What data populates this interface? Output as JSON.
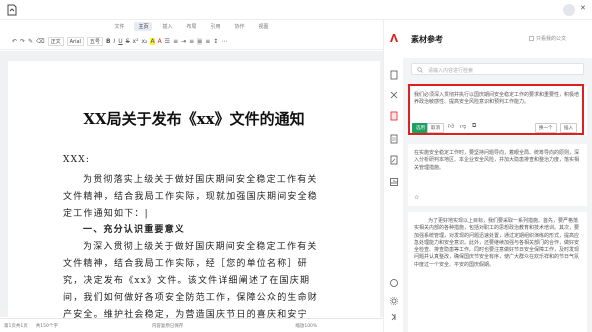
{
  "menu": {
    "tabs": [
      "文件",
      "主页",
      "插入",
      "布局",
      "引用",
      "协作",
      "视图"
    ],
    "active": "主页"
  },
  "toolbar": {
    "font_style": "正文",
    "font_name": "Arial",
    "font_size": "五号"
  },
  "document": {
    "title": "XX局关于发布《xx》文件的通知",
    "lines": [
      "XXX:",
      "为贯彻落实上级关于做好国庆期间安全稳定工作有关",
      "文件精神，结合我局工作实际，现就加强国庆期间安全稳",
      "定工作通知如下：|",
      "一、充分认识重要意义",
      "为深入贯彻上级关于做好国庆期间安全稳定工作有关",
      "文件精神，结合我局工作实际，经［您的单位名称］研",
      "究，决定发布《xx》文件。该文件详细阐述了在国庆期",
      "间，我们如何做好各项安全防范工作，保障公众的生命财",
      "产安全。维护社会稳定，为营造国庆节日的喜庆和安宁"
    ]
  },
  "status": {
    "page": "第1页共1页",
    "words": "共150个字",
    "doc_state": "内容复原已保存",
    "zoom": "缩放100%"
  },
  "panel": {
    "title": "素材参考",
    "mine_label": "只看我的公文",
    "search_placeholder": "请输入内容进行检索",
    "highlighted_card": {
      "text": "我们必须深入贯彻并执行以国庆期间安全稳定工作的要求和重要性，积极培养政治敏感性、提高安全风险意识和预判工作能力。",
      "actions": {
        "select": "选用",
        "cancel": "取消",
        "replace": "换一个",
        "insert": "插入"
      }
    },
    "card2_text": "在实施安全稳定工作时，要坚持问题导向，着眼全局、统筹导向的原则，深入分析研判本地区、本企业安全风险，并加大隐患排查和整治力度，落实相关管理措施。",
    "card3_text": "为了更好地实现以上目标，我们要采取一系列措施。首先，要严格落实相关内部的各种措施，包括对职工的思想政治教育和技术培训。其次，要加强系统管理，对发现的问题迅速处置，通过定期组织演练的形式，提高应急处理能力和安全意识。此外，还要继续加强与各相关部门的合作，做好安全检查、排查隐患等工作。同时也要注意做好节日安全保障工作，及时发现问题并认真整改，确保国庆节安全有序，使广大群众在欢乐祥和的节日气氛中度过一个安全、平安的国庆假期。"
  },
  "colors": {
    "accent": "#e02020",
    "select_green": "#19a15f"
  },
  "icons": [
    "app-logo",
    "user-avatar",
    "close-icon",
    "panel-logo-icon",
    "document-icon",
    "tools-icon",
    "material-icon",
    "outline-icon",
    "edit-icon",
    "chart-icon",
    "help-icon",
    "settings-icon",
    "collapse-icon",
    "search-icon",
    "thumb-up-icon",
    "thumb-down-icon",
    "copy-icon",
    "star-icon"
  ]
}
